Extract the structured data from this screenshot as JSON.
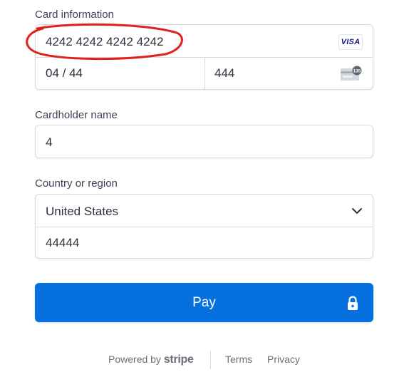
{
  "card": {
    "section_label": "Card information",
    "number": "4242 4242 4242 4242",
    "brand": "VISA",
    "expiry": "04 / 44",
    "cvc": "444",
    "cvc_badge": "135"
  },
  "cardholder": {
    "label": "Cardholder name",
    "value": "4"
  },
  "country": {
    "label": "Country or region",
    "selected": "United States",
    "postal_code": "44444"
  },
  "pay": {
    "label": "Pay",
    "color": "#0570de"
  },
  "footer": {
    "powered_by": "Powered by",
    "brand": "stripe",
    "terms": "Terms",
    "privacy": "Privacy"
  },
  "annotation": {
    "color": "#e0201b",
    "shape": "hand-drawn circle around card number"
  }
}
